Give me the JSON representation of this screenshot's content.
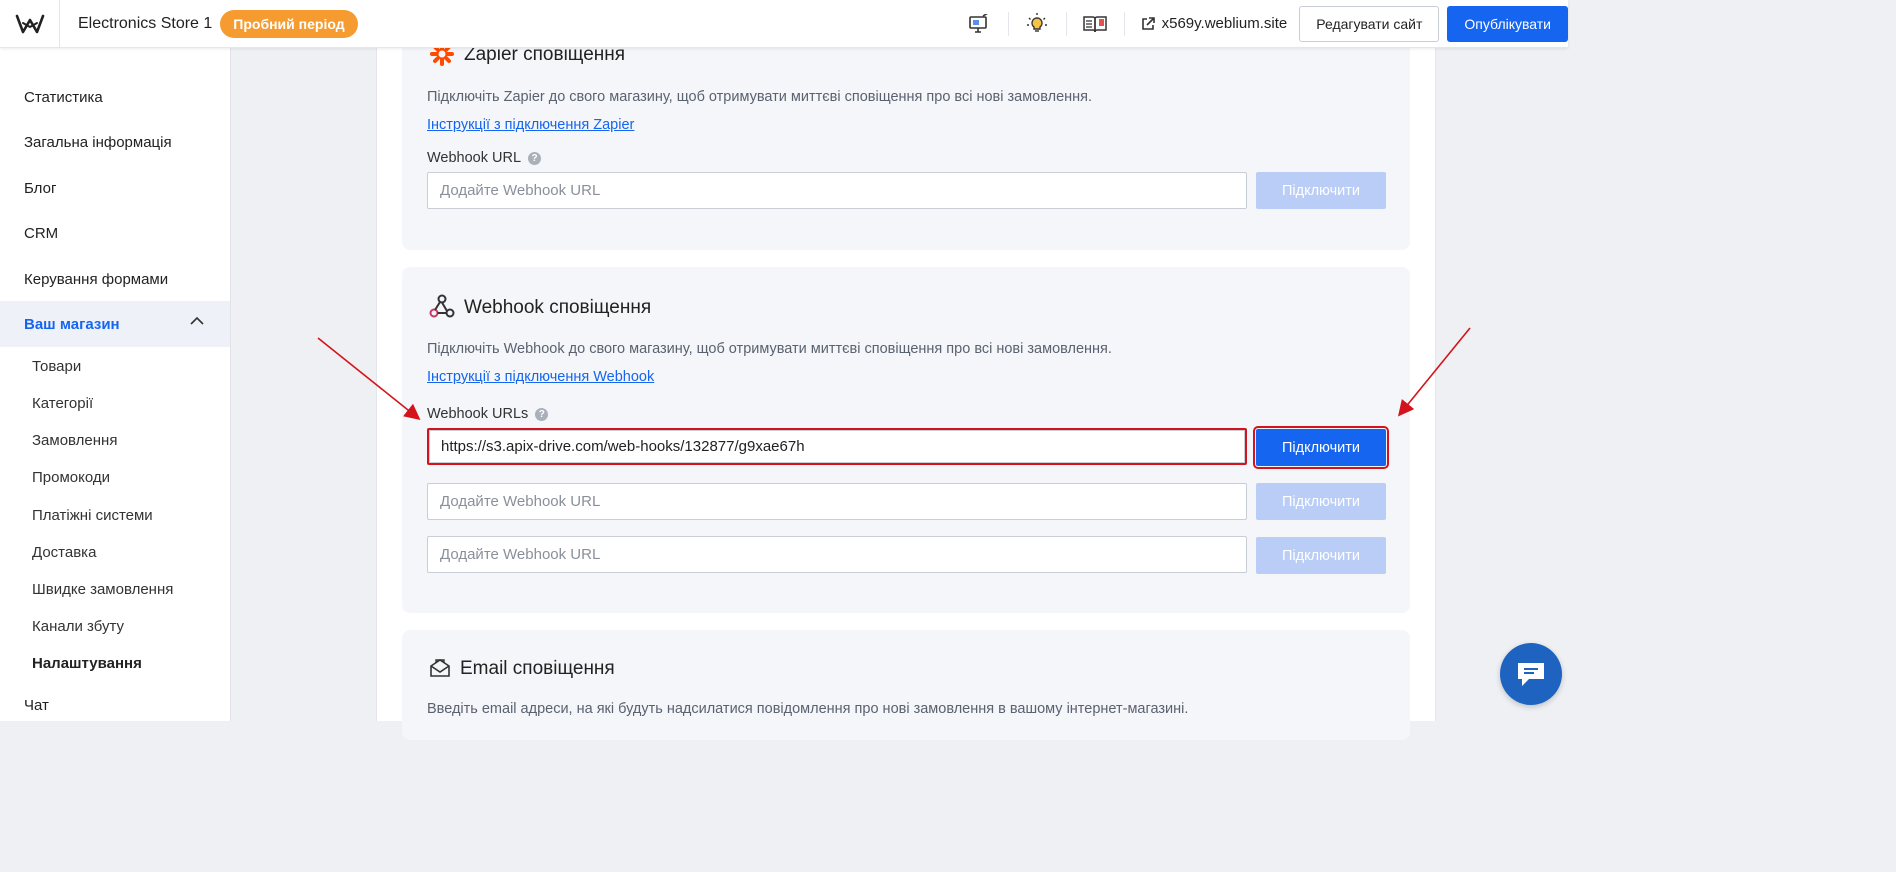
{
  "header": {
    "store_name": "Electronics Store 1",
    "trial_badge": "Пробний період",
    "site_link": "x569y.weblium.site",
    "edit_button": "Редагувати сайт",
    "publish_button": "Опублікувати",
    "icons": [
      "logo-icon",
      "monitor-edit-icon",
      "lightbulb-icon",
      "book-icon",
      "external-link-icon"
    ]
  },
  "sidebar": {
    "items": [
      {
        "label": "Статистика"
      },
      {
        "label": "Загальна інформація"
      },
      {
        "label": "Блог"
      },
      {
        "label": "CRM"
      },
      {
        "label": "Керування формами"
      },
      {
        "label": "Ваш магазин"
      },
      {
        "label": "Чат"
      }
    ],
    "subitems": [
      {
        "label": "Товари"
      },
      {
        "label": "Категорії"
      },
      {
        "label": "Замовлення"
      },
      {
        "label": "Промокоди"
      },
      {
        "label": "Платіжні системи"
      },
      {
        "label": "Доставка"
      },
      {
        "label": "Швидке замовлення"
      },
      {
        "label": "Канали збуту"
      },
      {
        "label": "Налаштування"
      }
    ]
  },
  "zapier": {
    "title": "Zapier сповіщення",
    "description": "Підключіть Zapier до свого магазину, щоб отримувати миттєві сповіщення про всі нові замовлення.",
    "link": "Інструкції з підключення Zapier",
    "field_label": "Webhook URL",
    "placeholder": "Додайте Webhook URL",
    "button": "Підключити"
  },
  "webhook": {
    "title": "Webhook сповіщення",
    "description": "Підключіть Webhook до свого магазину, щоб отримувати миттєві сповіщення про всі нові замовлення.",
    "link": "Інструкції з підключення Webhook",
    "field_label": "Webhook URLs",
    "rows": [
      {
        "value": "https://s3.apix-drive.com/web-hooks/132877/g9xae67h",
        "placeholder": "Додайте Webhook URL",
        "button": "Підключити"
      },
      {
        "value": "",
        "placeholder": "Додайте Webhook URL",
        "button": "Підключити"
      },
      {
        "value": "",
        "placeholder": "Додайте Webhook URL",
        "button": "Підключити"
      }
    ]
  },
  "email": {
    "title": "Email сповіщення",
    "description": "Введіть email адреси, на які будуть надсилатися повідомлення про нові замовлення в вашому інтернет-магазині."
  },
  "colors": {
    "accent": "#1565f0",
    "trial": "#f59b2f",
    "disabled_button": "#b9cdf7",
    "annotation": "#d4141c"
  }
}
